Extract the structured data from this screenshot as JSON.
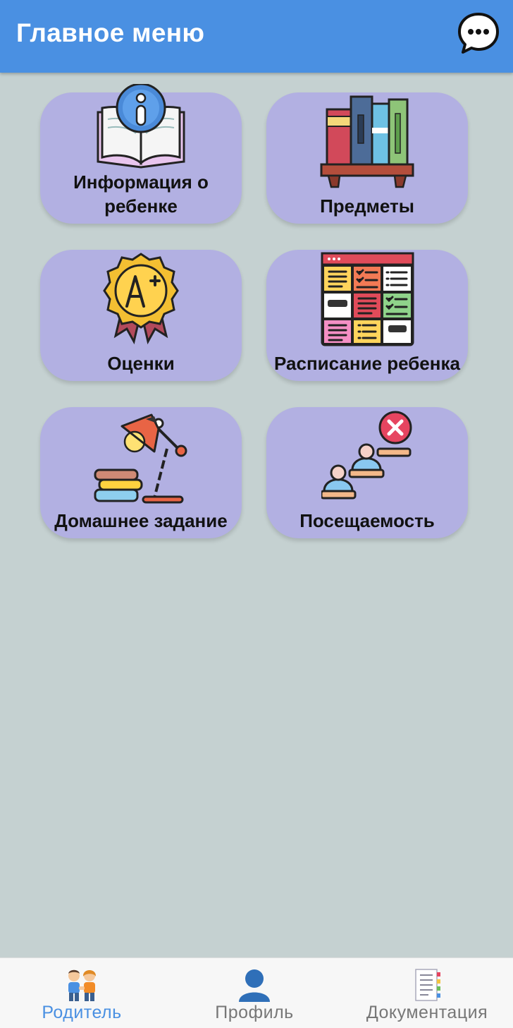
{
  "header": {
    "title": "Главное меню",
    "chat_icon": "chat-bubble-ellipsis-icon"
  },
  "menu": {
    "tiles": [
      {
        "label": "Информация о\nребенке",
        "icon": "info-book-icon"
      },
      {
        "label": "Предметы",
        "icon": "bookshelf-icon"
      },
      {
        "label": "Оценки",
        "icon": "grade-badge-icon"
      },
      {
        "label": "Расписание ребенка",
        "icon": "schedule-grid-icon"
      },
      {
        "label": "Домашнее задание",
        "icon": "desk-lamp-books-icon"
      },
      {
        "label": "Посещаемость",
        "icon": "attendance-icon"
      }
    ]
  },
  "tabbar": {
    "tabs": [
      {
        "label": "Родитель",
        "icon": "parents-icon",
        "active": true
      },
      {
        "label": "Профиль",
        "icon": "profile-icon",
        "active": false
      },
      {
        "label": "Документация",
        "icon": "documents-icon",
        "active": false
      }
    ]
  },
  "colors": {
    "header": "#4a90e2",
    "background": "#c5d1d1",
    "tile": "#b2b0e2",
    "tab_active": "#4a90e2",
    "tab_inactive": "#777777"
  }
}
